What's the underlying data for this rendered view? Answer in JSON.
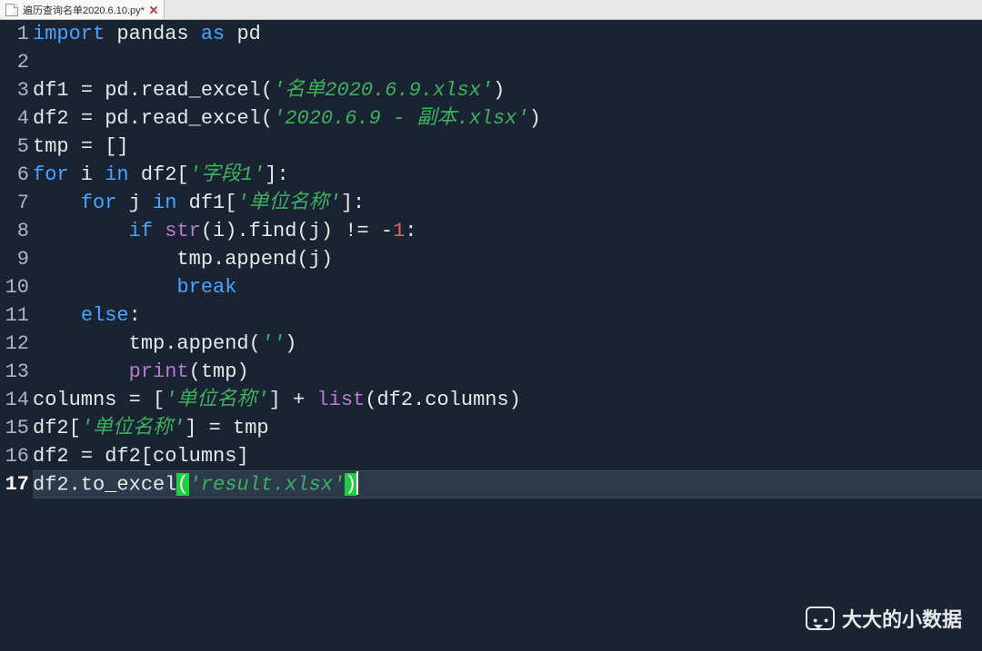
{
  "tab": {
    "filename": "遍历查询名单2020.6.10.py*"
  },
  "watermark": {
    "text": "大大的小数据"
  },
  "code": {
    "lines": [
      {
        "n": 1,
        "tokens": [
          [
            "kw-import",
            "import"
          ],
          [
            "ident",
            " pandas "
          ],
          [
            "kw-as",
            "as"
          ],
          [
            "ident",
            " pd"
          ]
        ]
      },
      {
        "n": 2,
        "tokens": []
      },
      {
        "n": 3,
        "tokens": [
          [
            "ident",
            "df1 "
          ],
          [
            "punct",
            "="
          ],
          [
            "ident",
            " pd.read_excel("
          ],
          [
            "str",
            "'名单2020.6.9.xlsx'"
          ],
          [
            "punct",
            ")"
          ]
        ]
      },
      {
        "n": 4,
        "tokens": [
          [
            "ident",
            "df2 "
          ],
          [
            "punct",
            "="
          ],
          [
            "ident",
            " pd.read_excel("
          ],
          [
            "str",
            "'2020.6.9 - 副本.xlsx'"
          ],
          [
            "punct",
            ")"
          ]
        ]
      },
      {
        "n": 5,
        "tokens": [
          [
            "ident",
            "tmp "
          ],
          [
            "punct",
            "="
          ],
          [
            "ident",
            " []"
          ]
        ]
      },
      {
        "n": 6,
        "tokens": [
          [
            "kw-for",
            "for"
          ],
          [
            "ident",
            " i "
          ],
          [
            "kw-in",
            "in"
          ],
          [
            "ident",
            " df2["
          ],
          [
            "str",
            "'字段1'"
          ],
          [
            "ident",
            "]:"
          ]
        ]
      },
      {
        "n": 7,
        "tokens": [
          [
            "ident",
            "    "
          ],
          [
            "kw-for",
            "for"
          ],
          [
            "ident",
            " j "
          ],
          [
            "kw-in",
            "in"
          ],
          [
            "ident",
            " df1["
          ],
          [
            "str",
            "'单位名称'"
          ],
          [
            "ident",
            "]:"
          ]
        ]
      },
      {
        "n": 8,
        "tokens": [
          [
            "ident",
            "        "
          ],
          [
            "kw-if",
            "if"
          ],
          [
            "ident",
            " "
          ],
          [
            "builtin",
            "str"
          ],
          [
            "ident",
            "(i).find(j) != -"
          ],
          [
            "num",
            "1"
          ],
          [
            "ident",
            ":"
          ]
        ]
      },
      {
        "n": 9,
        "tokens": [
          [
            "ident",
            "            tmp.append(j)"
          ]
        ]
      },
      {
        "n": 10,
        "tokens": [
          [
            "ident",
            "            "
          ],
          [
            "kw-break",
            "break"
          ]
        ]
      },
      {
        "n": 11,
        "tokens": [
          [
            "ident",
            "    "
          ],
          [
            "kw-else",
            "else"
          ],
          [
            "ident",
            ":"
          ]
        ]
      },
      {
        "n": 12,
        "tokens": [
          [
            "ident",
            "        tmp.append("
          ],
          [
            "str",
            "''"
          ],
          [
            "ident",
            ")"
          ]
        ]
      },
      {
        "n": 13,
        "tokens": [
          [
            "ident",
            "        "
          ],
          [
            "builtin",
            "print"
          ],
          [
            "ident",
            "(tmp)"
          ]
        ]
      },
      {
        "n": 14,
        "tokens": [
          [
            "ident",
            "columns "
          ],
          [
            "punct",
            "="
          ],
          [
            "ident",
            " ["
          ],
          [
            "str",
            "'单位名称'"
          ],
          [
            "ident",
            "] + "
          ],
          [
            "builtin",
            "list"
          ],
          [
            "ident",
            "(df2.columns)"
          ]
        ]
      },
      {
        "n": 15,
        "tokens": [
          [
            "ident",
            "df2["
          ],
          [
            "str",
            "'单位名称'"
          ],
          [
            "ident",
            "] "
          ],
          [
            "punct",
            "="
          ],
          [
            "ident",
            " tmp"
          ]
        ]
      },
      {
        "n": 16,
        "tokens": [
          [
            "ident",
            "df2 "
          ],
          [
            "punct",
            "="
          ],
          [
            "ident",
            " df2[columns]"
          ]
        ]
      },
      {
        "n": 17,
        "current": true,
        "tokens": [
          [
            "ident",
            "df2.to_excel"
          ],
          [
            "paren-hl",
            "("
          ],
          [
            "str",
            "'result.xlsx'"
          ],
          [
            "paren-hl",
            ")"
          ],
          [
            "cursor",
            ""
          ]
        ]
      }
    ]
  }
}
